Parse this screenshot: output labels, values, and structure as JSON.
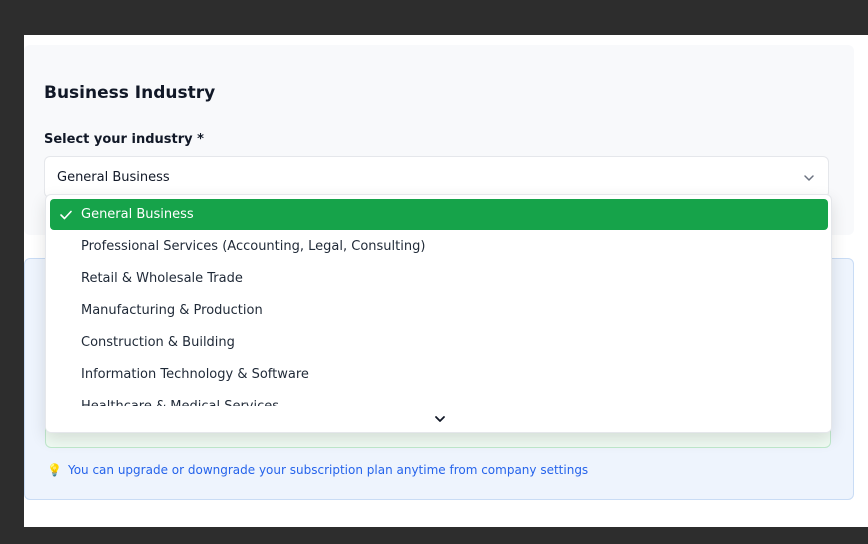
{
  "section": {
    "title": "Business Industry",
    "field_label": "Select your industry *",
    "selected_value": "General Business"
  },
  "dropdown": {
    "options": [
      {
        "label": "General Business",
        "selected": true
      },
      {
        "label": "Professional Services (Accounting, Legal, Consulting)",
        "selected": false
      },
      {
        "label": "Retail & Wholesale Trade",
        "selected": false
      },
      {
        "label": "Manufacturing & Production",
        "selected": false
      },
      {
        "label": "Construction & Building",
        "selected": false
      },
      {
        "label": "Information Technology & Software",
        "selected": false
      },
      {
        "label": "Healthcare & Medical Services",
        "selected": false
      }
    ]
  },
  "plan": {
    "hint": "You can upgrade or downgrade your subscription plan anytime from company settings",
    "hint_icon": "lightbulb-icon"
  },
  "colors": {
    "selected_bg": "#16a34a",
    "hint_text": "#2563eb"
  }
}
